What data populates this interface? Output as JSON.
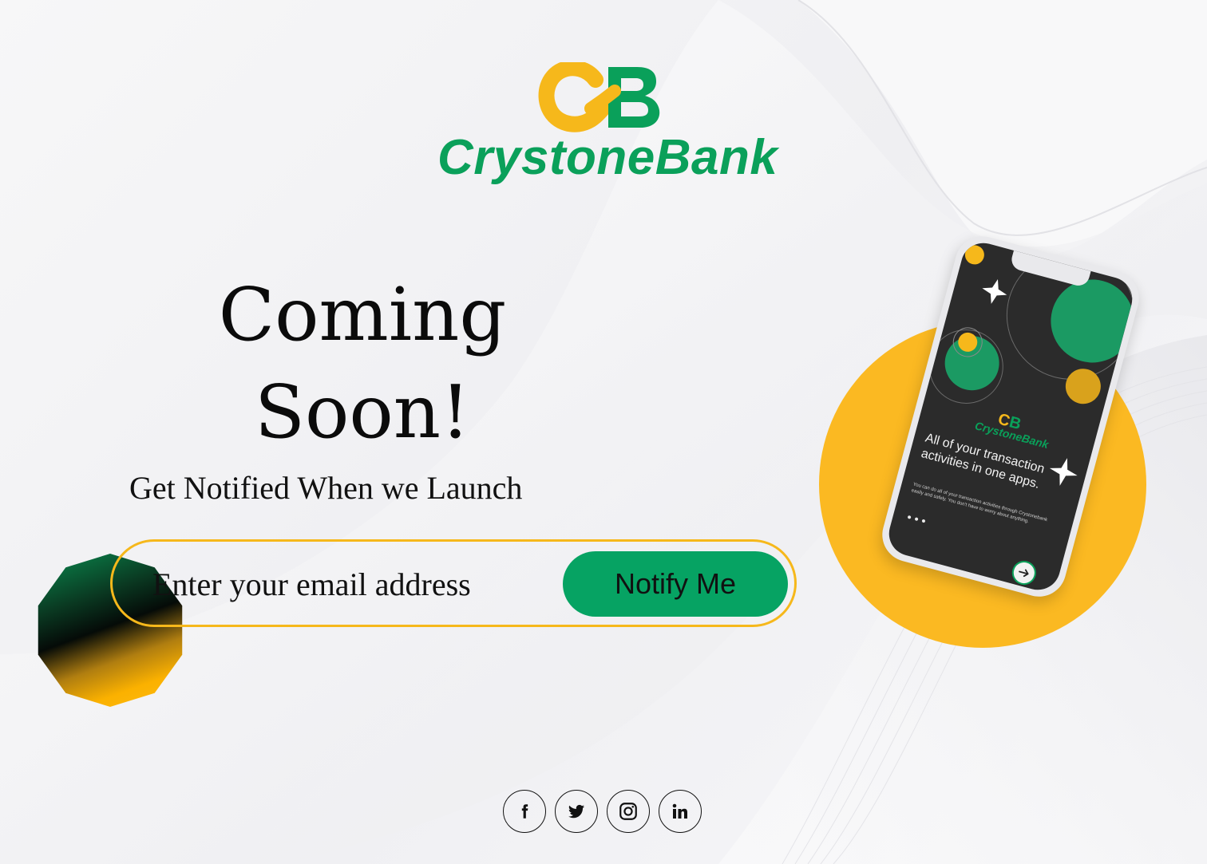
{
  "brand": {
    "name": "CrystoneBank",
    "mark_letters": [
      "C",
      "B"
    ],
    "colors": {
      "green": "#0aa05a",
      "yellow": "#f6b81b",
      "button_green": "#06a363"
    }
  },
  "hero": {
    "title_line1": "Coming",
    "title_line2": "Soon!",
    "subtitle": "Get Notified When we Launch"
  },
  "form": {
    "email_placeholder": "Enter your email address",
    "email_value": "",
    "submit_label": "Notify Me"
  },
  "phone_preview": {
    "logo_text": "CrystoneBank",
    "headline": "All of your transaction activities in one apps.",
    "body": "You can do all of your transaction activities through Crystonebank easily and safely. You don't have to worry about anything.",
    "dots": "•••",
    "next_icon": "arrow-right-icon"
  },
  "social": [
    {
      "name": "facebook",
      "icon": "facebook-icon"
    },
    {
      "name": "twitter",
      "icon": "twitter-icon"
    },
    {
      "name": "instagram",
      "icon": "instagram-icon"
    },
    {
      "name": "linkedin",
      "icon": "linkedin-icon"
    }
  ]
}
